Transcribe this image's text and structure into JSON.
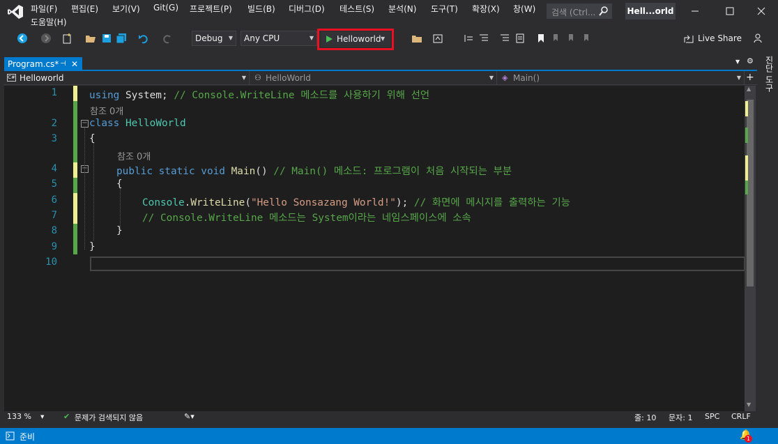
{
  "menu": {
    "items": [
      "파일(F)",
      "편집(E)",
      "보기(V)",
      "Git(G)",
      "프로젝트(P)",
      "빌드(B)",
      "디버그(D)",
      "테스트(S)",
      "분석(N)",
      "도구(T)",
      "확장(X)",
      "창(W)"
    ],
    "help": "도움말(H)"
  },
  "search": {
    "placeholder": "검색 (Ctrl..."
  },
  "solution_name": "Hell...orld",
  "toolbar": {
    "config": "Debug",
    "platform": "Any CPU",
    "run_target": "Helloworld",
    "live_share": "Live Share"
  },
  "tab": {
    "label": "Program.cs*"
  },
  "navbar": {
    "project": "Helloworld",
    "class": "HelloWorld",
    "member": "Main()"
  },
  "editor": {
    "line_numbers": [
      "1",
      "2",
      "3",
      "4",
      "5",
      "6",
      "7",
      "8",
      "9",
      "10"
    ],
    "refs": [
      "참조 0개",
      "참조 0개"
    ],
    "line1": {
      "kw": "using",
      "rest": " System; ",
      "comment": "// Console.WriteLine 메소드를 사용하기 위해 선언"
    },
    "line2": {
      "kw": "class",
      "cls": "HelloWorld"
    },
    "line3": "{",
    "line4": {
      "kw": "public static void",
      "fn": "Main",
      "rest": "() ",
      "comment": "// Main() 메소드: 프로그램이 처음 시작되는 부분"
    },
    "line5": "{",
    "line6": {
      "cls": "Console",
      "dot": ".",
      "fn": "WriteLine",
      "open": "(",
      "str": "\"Hello Sonsazang World!\"",
      "close": "); ",
      "comment": "// 화면에 메시지를 출력하는 기능"
    },
    "line7": {
      "comment": "// Console.WriteLine 메소드는 System이라는 네임스페이스에 소속"
    },
    "line8": "}",
    "line9": "}"
  },
  "side_tab": "진단 도구",
  "editor_status": {
    "zoom": "133 %",
    "issues": "문제가 검색되지 않음",
    "line": "줄: 10",
    "col": "문자: 1",
    "spc": "SPC",
    "crlf": "CRLF"
  },
  "status": {
    "ready": "준비",
    "notifications": "1"
  },
  "colors": {
    "accent": "#007acc",
    "run_highlight": "#e81123",
    "changed_saved": "#57a64a",
    "changed_unsaved": "#efef91"
  }
}
